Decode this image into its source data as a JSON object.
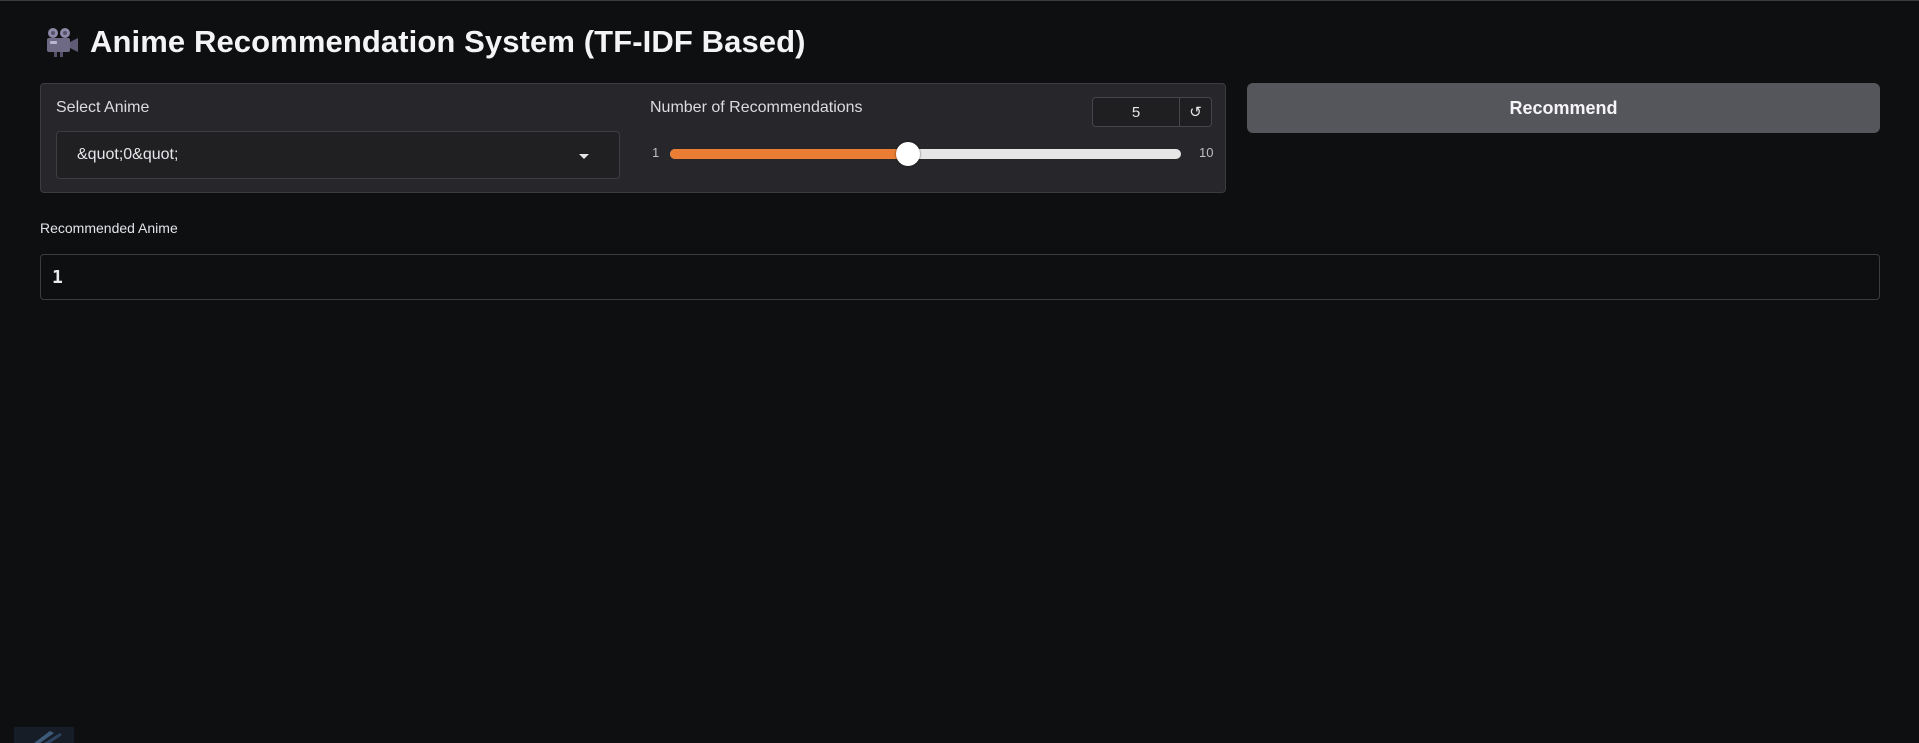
{
  "app": {
    "title": "Anime Recommendation System (TF-IDF Based)",
    "title_icon": "movie-camera-icon"
  },
  "form": {
    "select": {
      "label": "Select Anime",
      "value": "&quot;0&quot;"
    },
    "slider": {
      "label": "Number of Recommendations",
      "value": "5",
      "min": "1",
      "max": "10",
      "level_fraction": 0.444,
      "reset_glyph": "↺"
    },
    "recommend_label": "Recommend"
  },
  "output": {
    "label": "Recommended Anime",
    "value": "1"
  },
  "colors": {
    "accent": "#e87d33",
    "background": "#0e0f11",
    "panel": "#27272b",
    "button": "#55555c"
  }
}
